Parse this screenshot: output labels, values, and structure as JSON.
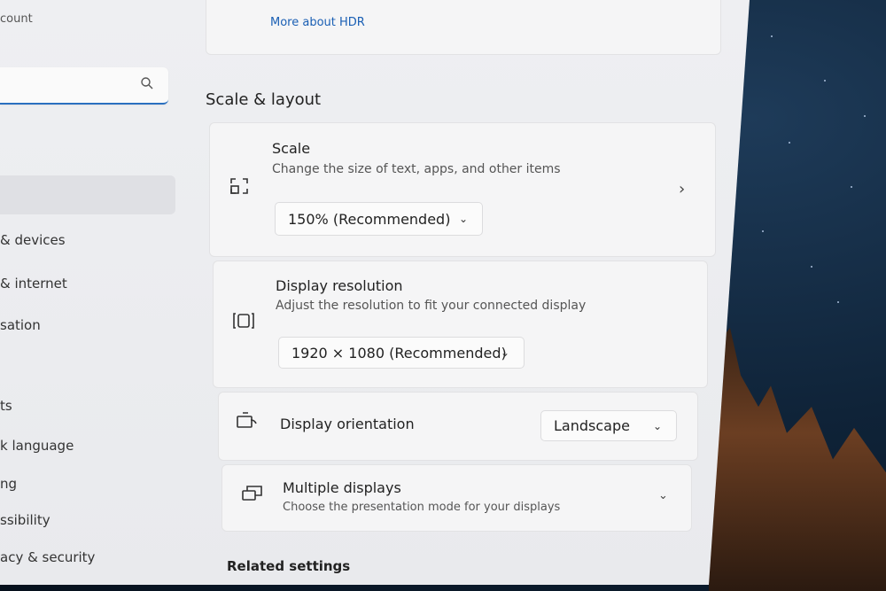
{
  "sidebar": {
    "account_fragment": "count",
    "search": {
      "placeholder": "",
      "icon": "search-icon"
    },
    "items": [
      {
        "label": "& devices"
      },
      {
        "label": "& internet"
      },
      {
        "label": "sation"
      },
      {
        "label": "ts"
      },
      {
        "label": "k language"
      },
      {
        "label": "ng"
      },
      {
        "label": "ssibility"
      },
      {
        "label": "acy & security"
      }
    ]
  },
  "hdr": {
    "link": "More about HDR"
  },
  "section": {
    "title": "Scale & layout"
  },
  "scale": {
    "title": "Scale",
    "subtitle": "Change the size of text, apps, and other items",
    "value": "150% (Recommended)",
    "icon": "scale-icon"
  },
  "resolution": {
    "title": "Display resolution",
    "subtitle": "Adjust the resolution to fit your connected display",
    "value": "1920 × 1080 (Recommended)",
    "icon": "resolution-icon"
  },
  "orientation": {
    "title": "Display orientation",
    "value": "Landscape",
    "icon": "orientation-icon"
  },
  "multiple": {
    "title": "Multiple displays",
    "subtitle": "Choose the presentation mode for your displays",
    "icon": "multiple-displays-icon"
  },
  "related": {
    "title": "Related settings"
  },
  "colors": {
    "accent": "#2a6fbf",
    "window_bg": "#eeeff2",
    "card_bg": "#f5f5f6"
  }
}
